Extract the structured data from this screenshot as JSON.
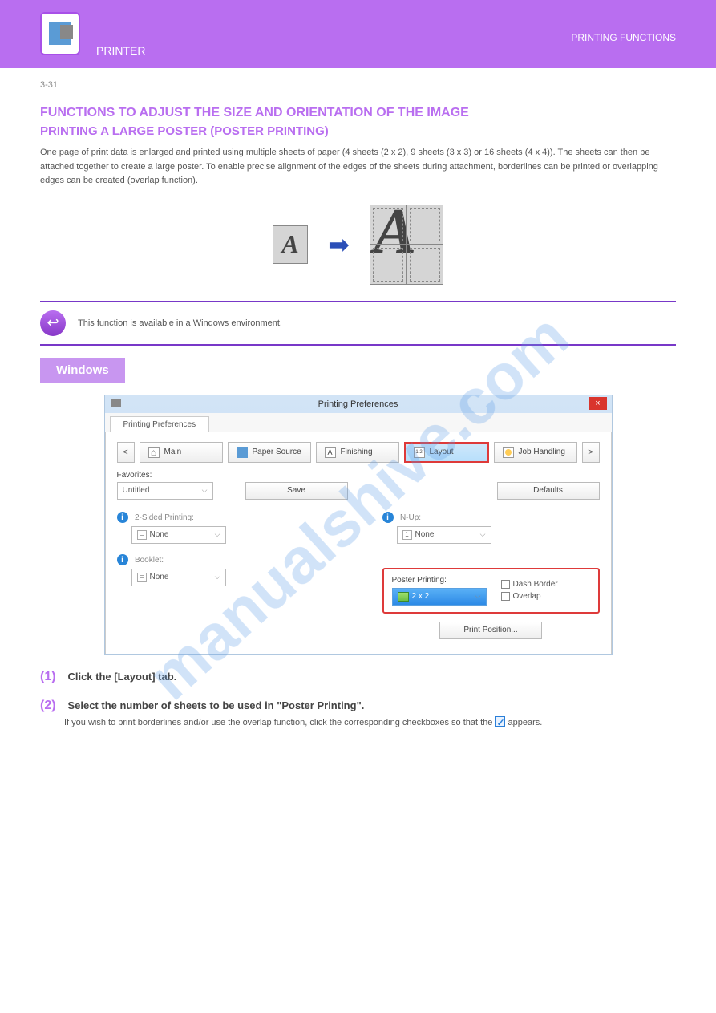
{
  "watermark": "manualshive.com",
  "header": {
    "title_left": "PRINTER",
    "title_right": "PRINTING FUNCTIONS"
  },
  "page_number": "3-31",
  "heading": "PRINTING A LARGE POSTER (POSTER PRINTING)",
  "intro": "One page of print data is enlarged and printed using multiple sheets of paper (4 sheets (2 x 2), 9 sheets (3 x 3) or 16 sheets (4 x 4)). The sheets can then be attached together to create a large poster. To enable precise alignment of the edges of the sheets during attachment, borderlines can be printed or overlapping edges can be created (overlap function).",
  "note": "This function is available in a Windows environment.",
  "os_label": "Windows",
  "screenshot": {
    "title": "Printing Preferences",
    "file_tab": "Printing Preferences",
    "nav_prev": "<",
    "nav_next": ">",
    "tabs": {
      "main": "Main",
      "paper": "Paper Source",
      "finishing": "Finishing",
      "layout": "Layout",
      "job": "Job Handling"
    },
    "favorites_label": "Favorites:",
    "favorites_value": "Untitled",
    "save_btn": "Save",
    "defaults_btn": "Defaults",
    "twosided_label": "2-Sided Printing:",
    "twosided_value": "None",
    "booklet_label": "Booklet:",
    "booklet_value": "None",
    "nup_label": "N-Up:",
    "nup_prefix": "1",
    "nup_value": "None",
    "poster_label": "Poster Printing:",
    "poster_value": "2 x 2",
    "dash_border": "Dash Border",
    "overlap": "Overlap",
    "printpos": "Print Position..."
  },
  "steps": {
    "s1": {
      "num": "(1)",
      "title": "Click the [Layout] tab."
    },
    "s2": {
      "num": "(2)",
      "title": "Select the number of sheets to be used in \"Poster Printing\".",
      "body_a": "If you wish to print borderlines and/or use the overlap function, click the corresponding checkboxes so that the ",
      "body_b": " appears."
    }
  }
}
